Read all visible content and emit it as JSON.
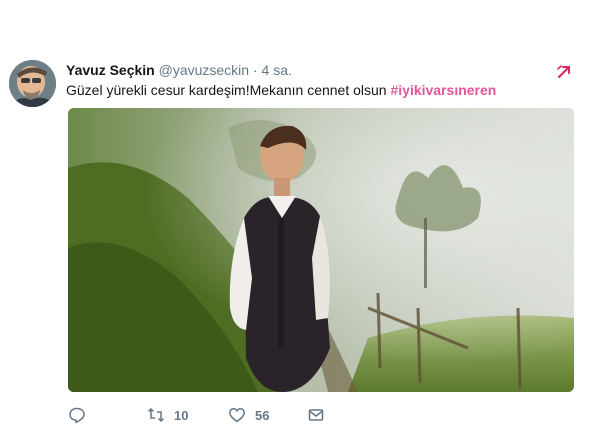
{
  "tweet": {
    "author_name": "Yavuz Seçkin",
    "author_handle": "@yavuzseckin",
    "separator": "·",
    "time": "4 sa.",
    "text": "Güzel yürekli cesur kardeşim!Mekanın cennet olsun ",
    "hashtag": "#iyikivarsıneren",
    "hashtag_color": "#e0559b"
  },
  "actions": {
    "reply_icon": "reply-icon",
    "retweet_icon": "retweet-icon",
    "retweet_count": "10",
    "like_icon": "heart-icon",
    "like_count": "56",
    "dm_icon": "envelope-icon"
  },
  "menu": {
    "icon": "caret-icon",
    "color": "#e0245e"
  },
  "colors": {
    "text": "#14171a",
    "secondary": "#657786"
  }
}
